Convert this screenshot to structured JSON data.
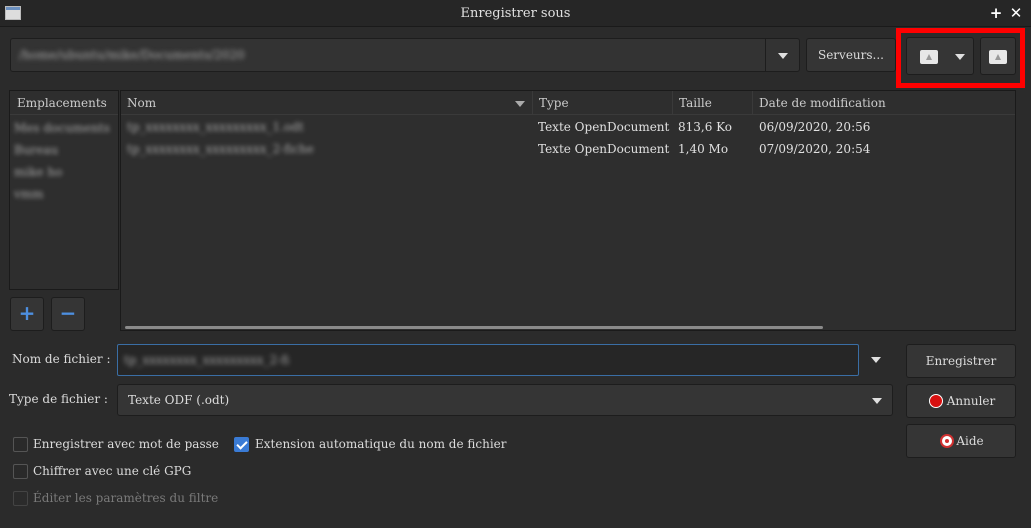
{
  "window": {
    "title": "Enregistrer sous",
    "maximize_glyph": "+",
    "close_glyph": "✕"
  },
  "path_bar": {
    "value": "/home/ubuntu/mike/Documents/2020",
    "servers_label": "Serveurs..."
  },
  "places": {
    "header": "Emplacements",
    "items": [
      "Mes documents",
      "Bureau",
      "mike ho",
      "vmm"
    ],
    "add_label": "+",
    "remove_label": "−"
  },
  "file_list": {
    "columns": {
      "name": "Nom",
      "type": "Type",
      "size": "Taille",
      "modified": "Date de modification"
    },
    "rows": [
      {
        "name": "tp_xxxxxxxx_xxxxxxxxx_1.odt",
        "type": "Texte OpenDocument",
        "size": "813,6 Ko",
        "modified": "06/09/2020, 20:56"
      },
      {
        "name": "tp_xxxxxxxx_xxxxxxxxx_2-fiche",
        "type": "Texte OpenDocument",
        "size": "1,40 Mo",
        "modified": "07/09/2020, 20:54"
      }
    ]
  },
  "form": {
    "filename_label": "Nom de fichier :",
    "filename_value": "tp_xxxxxxxx_xxxxxxxxx_2-fi",
    "filetype_label": "Type de fichier :",
    "filetype_value": "Texte ODF (.odt)"
  },
  "buttons": {
    "save": "Enregistrer",
    "cancel": "Annuler",
    "help": "Aide"
  },
  "options": {
    "password": {
      "label": "Enregistrer avec mot de passe",
      "checked": false
    },
    "auto_ext": {
      "label": "Extension automatique du nom de fichier",
      "checked": true
    },
    "gpg": {
      "label": "Chiffrer avec une clé GPG",
      "checked": false
    },
    "filter": {
      "label": "Éditer les paramètres du filtre",
      "checked": false,
      "disabled": true
    }
  },
  "colors": {
    "highlight": "#ff0000",
    "accent": "#3a7bd5",
    "background": "#2b2b2b"
  }
}
